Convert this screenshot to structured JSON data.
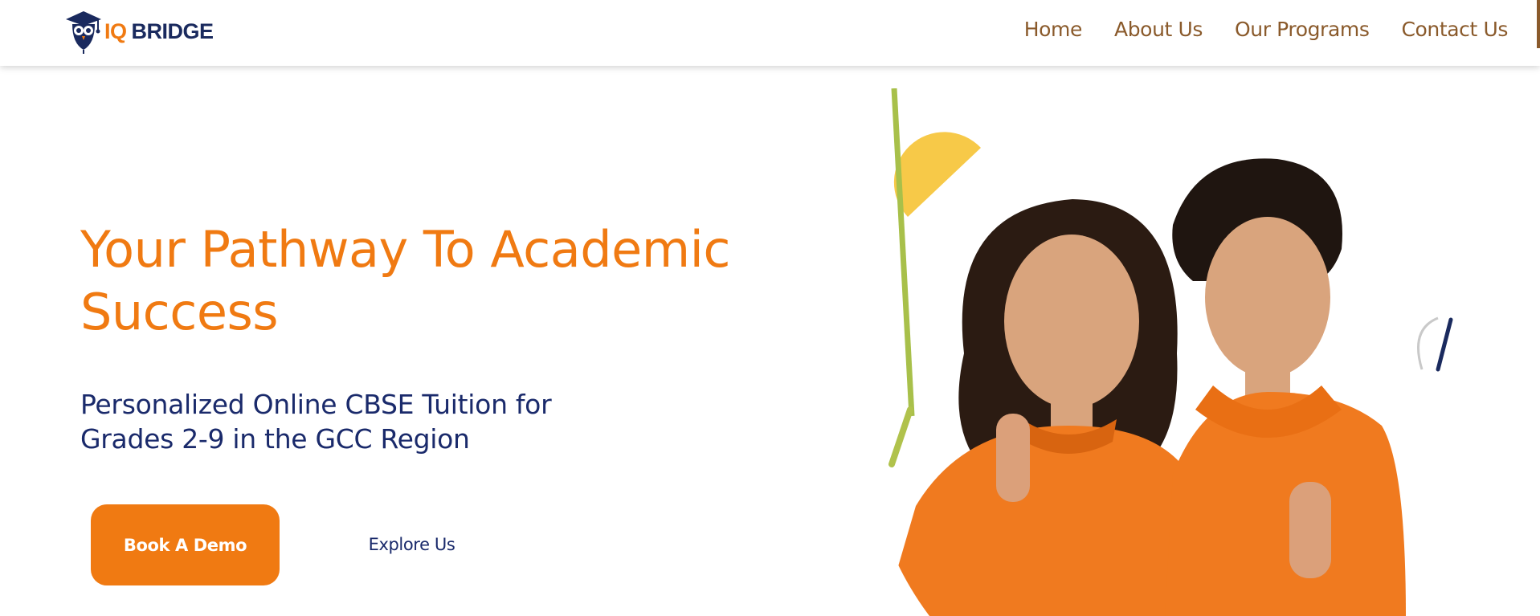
{
  "header": {
    "brand": {
      "prefix": "IQ",
      "name": "BRIDGE"
    },
    "nav": [
      {
        "label": "Home"
      },
      {
        "label": "About Us"
      },
      {
        "label": "Our Programs"
      },
      {
        "label": "Contact Us"
      }
    ]
  },
  "hero": {
    "title": "Your Pathway To Academic Success",
    "subtitle": "Personalized Online CBSE Tuition for Grades 2-9 in the GCC Region",
    "primary_button": "Book A Demo",
    "secondary_button": "Explore Us",
    "image": "two-smiling-students-thumbs-up-photo"
  },
  "colors": {
    "accent": "#f07a12",
    "navy": "#1a2a6b",
    "nav_link": "#8a5a2b",
    "shirt": "#f07a1f"
  }
}
